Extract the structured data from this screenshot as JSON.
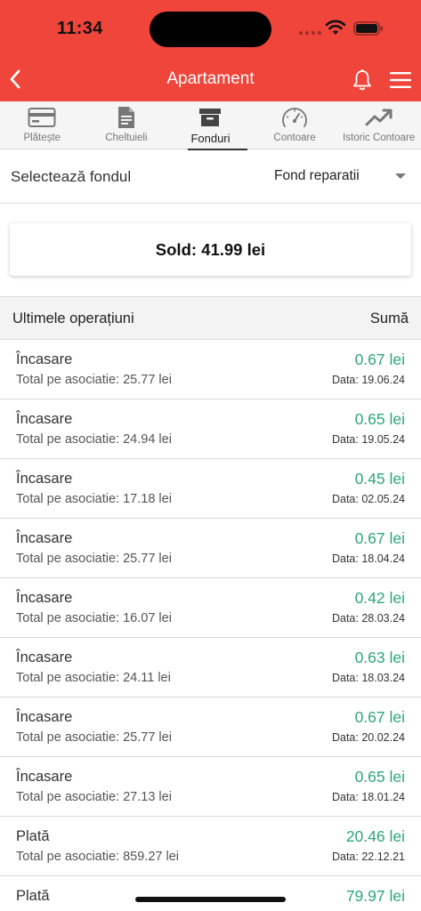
{
  "status_bar": {
    "time": "11:34"
  },
  "header": {
    "title": "Apartament"
  },
  "tabs": [
    {
      "label": "Plătește",
      "icon": "credit-card-icon",
      "active": false
    },
    {
      "label": "Cheltuieli",
      "icon": "document-icon",
      "active": false
    },
    {
      "label": "Fonduri",
      "icon": "archive-box-icon",
      "active": true
    },
    {
      "label": "Contoare",
      "icon": "gauge-icon",
      "active": false
    },
    {
      "label": "Istoric Contoare",
      "icon": "trend-up-icon",
      "active": false
    }
  ],
  "fund": {
    "label": "Selectează fondul",
    "selected": "Fond reparatii"
  },
  "sold": {
    "text": "Sold: 41.99 lei"
  },
  "operations": {
    "title": "Ultimele operațiuni",
    "sum_header": "Sumă",
    "items": [
      {
        "type": "Încasare",
        "total": "Total pe asociatie: 25.77 lei",
        "amount": "0.67 lei",
        "date": "Data: 19.06.24"
      },
      {
        "type": "Încasare",
        "total": "Total pe asociatie: 24.94 lei",
        "amount": "0.65 lei",
        "date": "Data: 19.05.24"
      },
      {
        "type": "Încasare",
        "total": "Total pe asociatie: 17.18 lei",
        "amount": "0.45 lei",
        "date": "Data: 02.05.24"
      },
      {
        "type": "Încasare",
        "total": "Total pe asociatie: 25.77 lei",
        "amount": "0.67 lei",
        "date": "Data: 18.04.24"
      },
      {
        "type": "Încasare",
        "total": "Total pe asociatie: 16.07 lei",
        "amount": "0.42 lei",
        "date": "Data: 28.03.24"
      },
      {
        "type": "Încasare",
        "total": "Total pe asociatie: 24.11 lei",
        "amount": "0.63 lei",
        "date": "Data: 18.03.24"
      },
      {
        "type": "Încasare",
        "total": "Total pe asociatie: 25.77 lei",
        "amount": "0.67 lei",
        "date": "Data: 20.02.24"
      },
      {
        "type": "Încasare",
        "total": "Total pe asociatie: 27.13 lei",
        "amount": "0.65 lei",
        "date": "Data: 18.01.24"
      },
      {
        "type": "Plată",
        "total": "Total pe asociatie: 859.27 lei",
        "amount": "20.46 lei",
        "date": "Data: 22.12.21"
      },
      {
        "type": "Plată",
        "total": "",
        "amount": "79.97 lei",
        "date": ""
      }
    ]
  },
  "colors": {
    "brand": "#f0453a",
    "amount": "#2ea57a"
  }
}
